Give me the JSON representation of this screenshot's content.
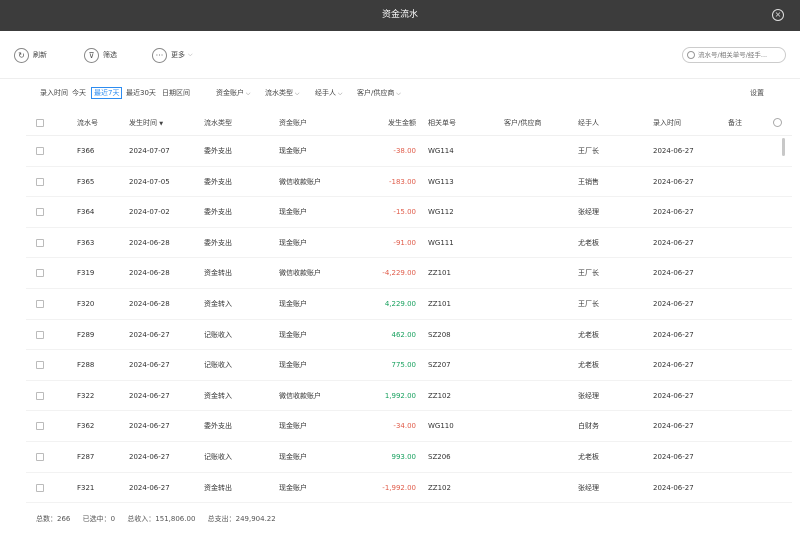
{
  "window": {
    "title": "资金流水",
    "close_icon": "×"
  },
  "toolbar": {
    "refresh_label": "刷新",
    "filter_label": "筛选",
    "more_label": "更多",
    "search_placeholder": "流水号/相关单号/经手..."
  },
  "filters": {
    "time_label": "录入时间",
    "today": "今天",
    "last7": "最近7天",
    "last30": "最近30天",
    "date_range": "日期区间",
    "account": "资金账户",
    "flow_type": "流水类型",
    "handler": "经手人",
    "customer": "客户/供应商",
    "settings": "设置"
  },
  "columns": {
    "flow_no": "流水号",
    "date": "发生时间",
    "sort_icon": "▼",
    "type": "流水类型",
    "account": "资金账户",
    "amount": "发生金额",
    "ref_no": "相关单号",
    "partner": "客户/供应商",
    "handler": "经手人",
    "entry_time": "录入时间",
    "remark": "备注"
  },
  "rows": [
    {
      "no": "F366",
      "date": "2024-07-07",
      "type": "委外支出",
      "account": "现金账户",
      "amount": "-38.00",
      "sign": "neg",
      "ref": "WG114",
      "partner": "",
      "handler": "王厂长",
      "entry": "2024-06-27",
      "remark": ""
    },
    {
      "no": "F365",
      "date": "2024-07-05",
      "type": "委外支出",
      "account": "微信收款账户",
      "amount": "-183.00",
      "sign": "neg",
      "ref": "WG113",
      "partner": "",
      "handler": "王销售",
      "entry": "2024-06-27",
      "remark": ""
    },
    {
      "no": "F364",
      "date": "2024-07-02",
      "type": "委外支出",
      "account": "现金账户",
      "amount": "-15.00",
      "sign": "neg",
      "ref": "WG112",
      "partner": "",
      "handler": "张经理",
      "entry": "2024-06-27",
      "remark": ""
    },
    {
      "no": "F363",
      "date": "2024-06-28",
      "type": "委外支出",
      "account": "现金账户",
      "amount": "-91.00",
      "sign": "neg",
      "ref": "WG111",
      "partner": "",
      "handler": "尤老板",
      "entry": "2024-06-27",
      "remark": ""
    },
    {
      "no": "F319",
      "date": "2024-06-28",
      "type": "资金转出",
      "account": "微信收款账户",
      "amount": "-4,229.00",
      "sign": "neg",
      "ref": "ZZ101",
      "partner": "",
      "handler": "王厂长",
      "entry": "2024-06-27",
      "remark": ""
    },
    {
      "no": "F320",
      "date": "2024-06-28",
      "type": "资金转入",
      "account": "现金账户",
      "amount": "4,229.00",
      "sign": "pos",
      "ref": "ZZ101",
      "partner": "",
      "handler": "王厂长",
      "entry": "2024-06-27",
      "remark": ""
    },
    {
      "no": "F289",
      "date": "2024-06-27",
      "type": "记账收入",
      "account": "现金账户",
      "amount": "462.00",
      "sign": "pos",
      "ref": "SZ208",
      "partner": "",
      "handler": "尤老板",
      "entry": "2024-06-27",
      "remark": ""
    },
    {
      "no": "F288",
      "date": "2024-06-27",
      "type": "记账收入",
      "account": "现金账户",
      "amount": "775.00",
      "sign": "pos",
      "ref": "SZ207",
      "partner": "",
      "handler": "尤老板",
      "entry": "2024-06-27",
      "remark": ""
    },
    {
      "no": "F322",
      "date": "2024-06-27",
      "type": "资金转入",
      "account": "微信收款账户",
      "amount": "1,992.00",
      "sign": "pos",
      "ref": "ZZ102",
      "partner": "",
      "handler": "张经理",
      "entry": "2024-06-27",
      "remark": ""
    },
    {
      "no": "F362",
      "date": "2024-06-27",
      "type": "委外支出",
      "account": "现金账户",
      "amount": "-34.00",
      "sign": "neg",
      "ref": "WG110",
      "partner": "",
      "handler": "白财务",
      "entry": "2024-06-27",
      "remark": ""
    },
    {
      "no": "F287",
      "date": "2024-06-27",
      "type": "记账收入",
      "account": "现金账户",
      "amount": "993.00",
      "sign": "pos",
      "ref": "SZ206",
      "partner": "",
      "handler": "尤老板",
      "entry": "2024-06-27",
      "remark": ""
    },
    {
      "no": "F321",
      "date": "2024-06-27",
      "type": "资金转出",
      "account": "现金账户",
      "amount": "-1,992.00",
      "sign": "neg",
      "ref": "ZZ102",
      "partner": "",
      "handler": "张经理",
      "entry": "2024-06-27",
      "remark": ""
    }
  ],
  "footer": {
    "total": "总数：266",
    "selected": "已选中：0",
    "income": "总收入：151,806.00",
    "expense": "总支出：249,904.22"
  },
  "colors": {
    "negative": "#e05d4b",
    "positive": "#19a15f",
    "accent": "#2d8cf0",
    "titlebar": "#3c3c3c"
  }
}
